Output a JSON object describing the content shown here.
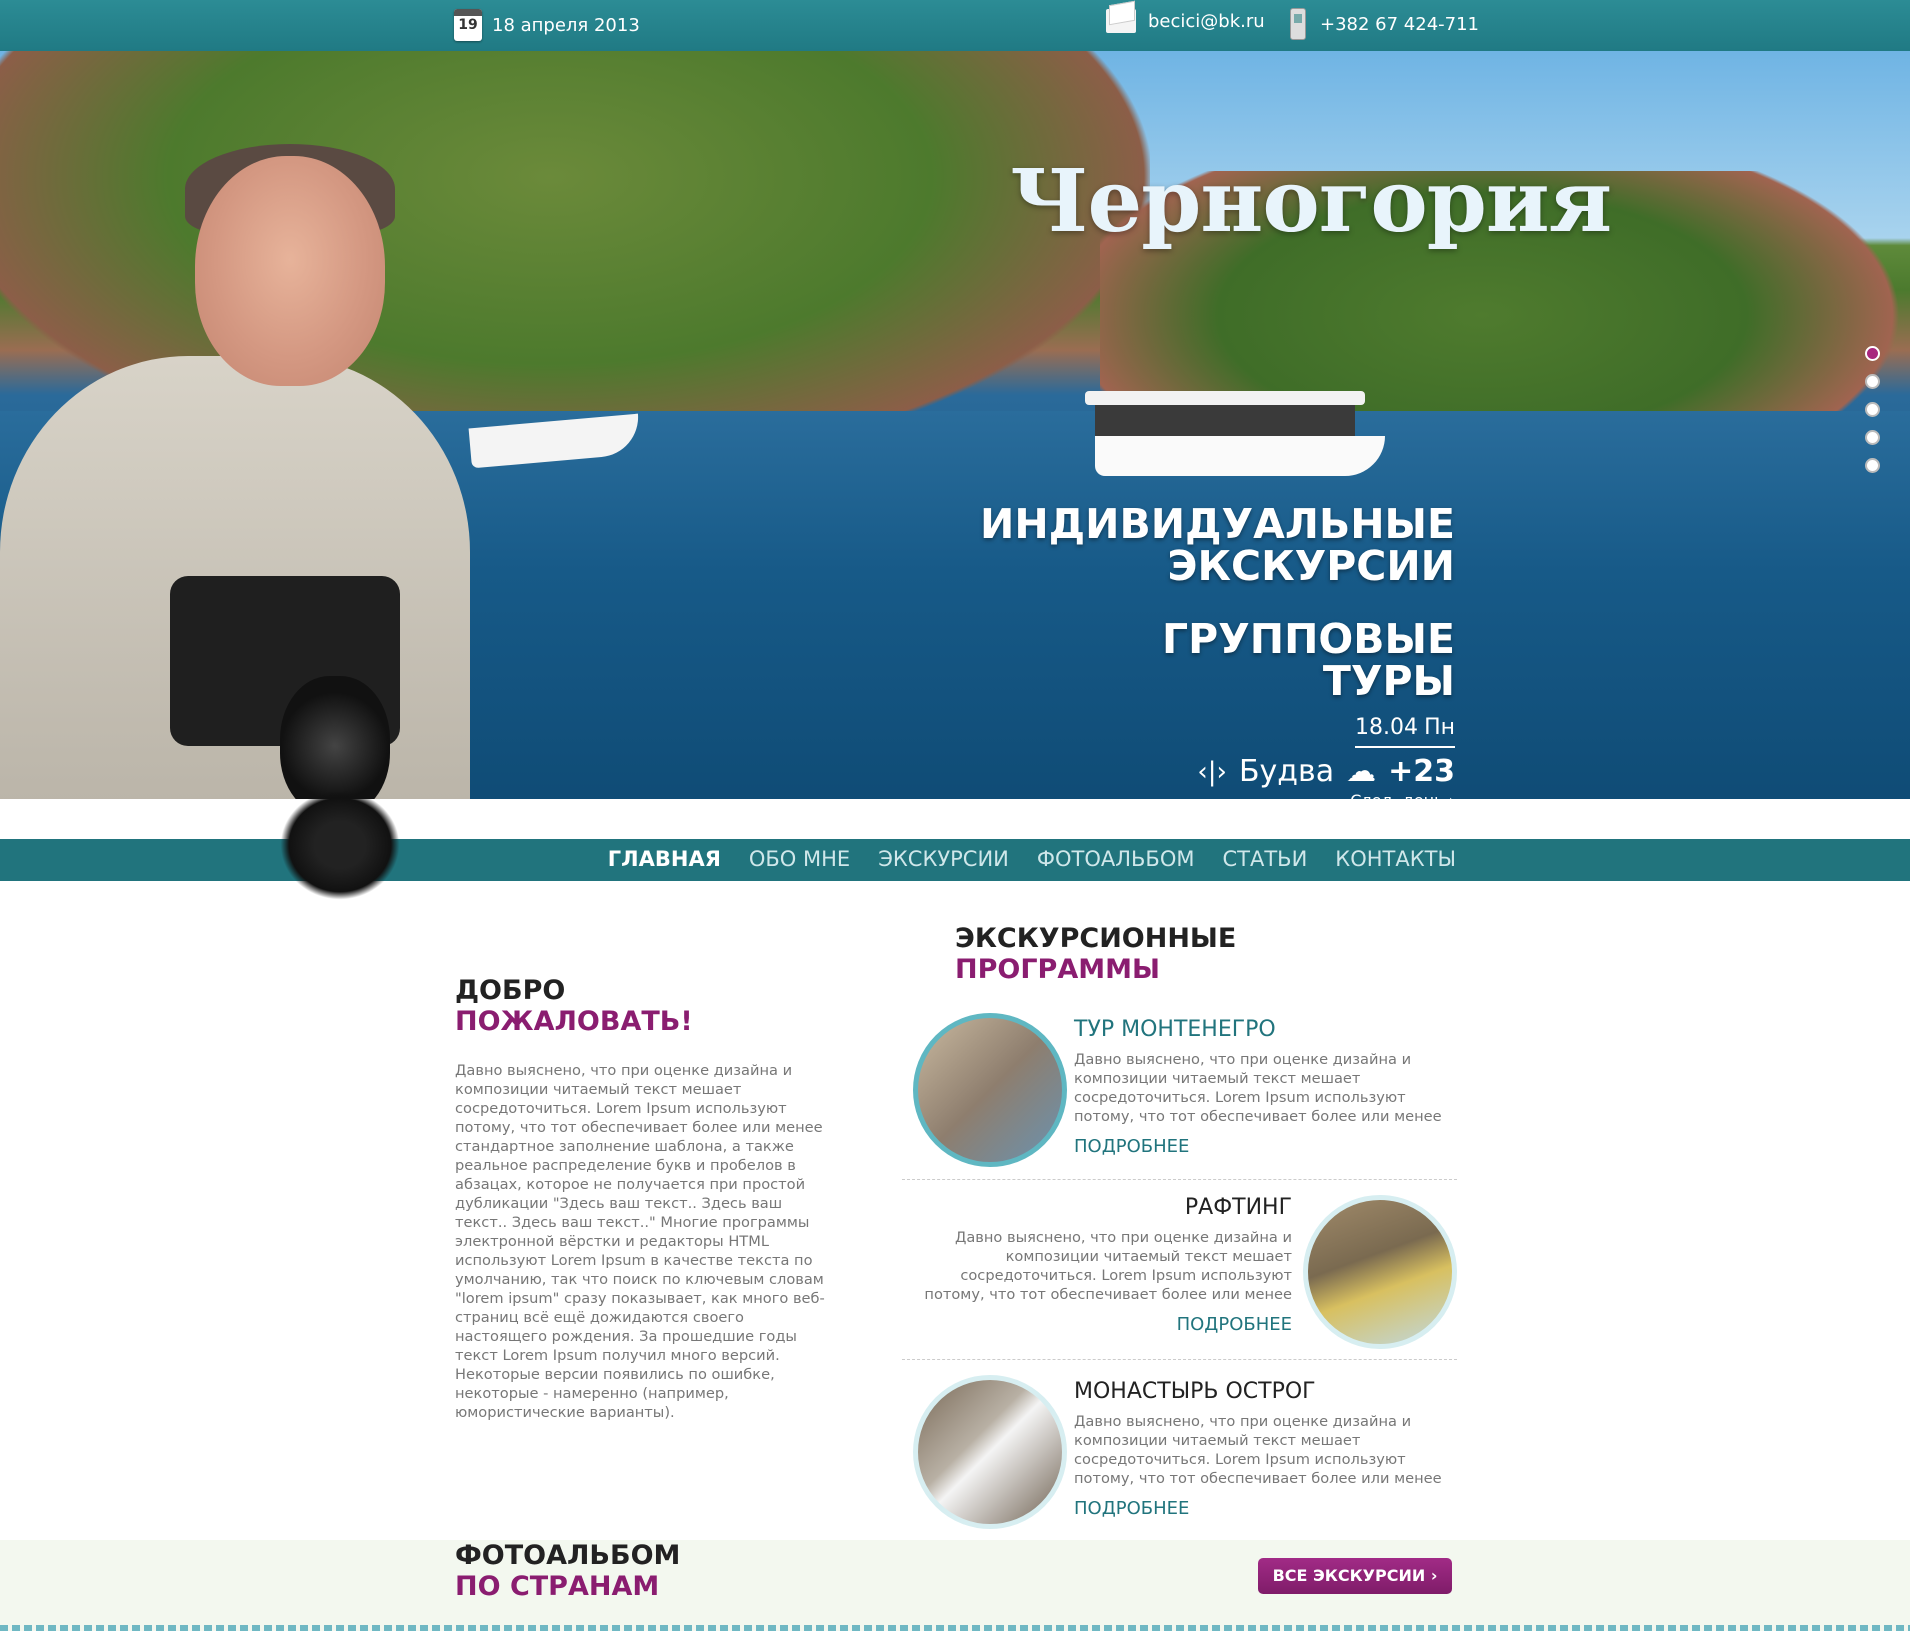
{
  "topbar": {
    "calendar_day": "19",
    "date": "18 апреля 2013",
    "email": "becici@bk.ru",
    "phone": "+382 67 424-711"
  },
  "hero": {
    "title": "Черногория",
    "slogan1_line1": "ИНДИВИДУАЛЬНЫЕ",
    "slogan1_line2": "ЭКСКУРСИИ",
    "slogan2_line1": "ГРУППОВЫЕ",
    "slogan2_line2": "ТУРЫ",
    "weather": {
      "date": "18.04",
      "weekday": "Пн",
      "city": "Будва",
      "temp": "+23",
      "next": "След. день"
    },
    "slider_dots": 5
  },
  "nav": {
    "items": [
      {
        "label": "ГЛАВНАЯ",
        "active": true
      },
      {
        "label": "ОБО МНЕ"
      },
      {
        "label": "ЭКСКУРСИИ"
      },
      {
        "label": "ФОТОАЛЬБОМ"
      },
      {
        "label": "СТАТЬИ"
      },
      {
        "label": "КОНТАКТЫ"
      }
    ]
  },
  "welcome": {
    "title1": "ДОБРО",
    "title2": "ПОЖАЛОВАТЬ!",
    "text": "Давно выяснено, что при оценке дизайна и композиции читаемый текст мешает сосредоточиться. Lorem Ipsum используют потому, что тот обеспечивает более или менее стандартное заполнение шаблона, а также реальное распределение букв и пробелов в абзацах, которое не получается при простой дубликации \"Здесь ваш текст.. Здесь ваш текст.. Здесь ваш текст..\" Многие программы электронной вёрстки и редакторы HTML используют Lorem Ipsum в качестве текста по умолчанию, так что поиск по ключевым словам \"lorem ipsum\" сразу показывает, как много веб-страниц всё ещё дожидаются своего настоящего рождения. За прошедшие годы текст Lorem Ipsum получил много версий. Некоторые версии появились по ошибке, некоторые - намеренно (например, юмористические варианты)."
  },
  "programs": {
    "title1": "ЭКСКУРСИОННЫЕ",
    "title2": "ПРОГРАММЫ",
    "items": [
      {
        "title": "ТУР МОНТЕНЕГРО",
        "text": "Давно выяснено, что при оценке дизайна и композиции читаемый текст мешает сосредоточиться. Lorem Ipsum используют потому, что тот обеспечивает более или менее",
        "more": "ПОДРОБНЕЕ"
      },
      {
        "title": "РАФТИНГ",
        "text": "Давно выяснено, что при оценке дизайна и композиции читаемый текст мешает сосредоточиться. Lorem Ipsum используют потому, что тот обеспечивает более или менее",
        "more": "ПОДРОБНЕЕ"
      },
      {
        "title": "МОНАСТЫРЬ ОСТРОГ",
        "text": "Давно выяснено, что при оценке дизайна и композиции читаемый текст мешает сосредоточиться. Lorem Ipsum используют потому, что тот обеспечивает более или менее",
        "more": "ПОДРОБНЕЕ"
      }
    ]
  },
  "album": {
    "title1": "ФОТОАЛЬБОМ",
    "title2": "ПО СТРАНАМ",
    "button": "ВСЕ ЭКСКУРСИИ"
  },
  "colors": {
    "teal": "#21747d",
    "purple": "#8a1d70"
  }
}
